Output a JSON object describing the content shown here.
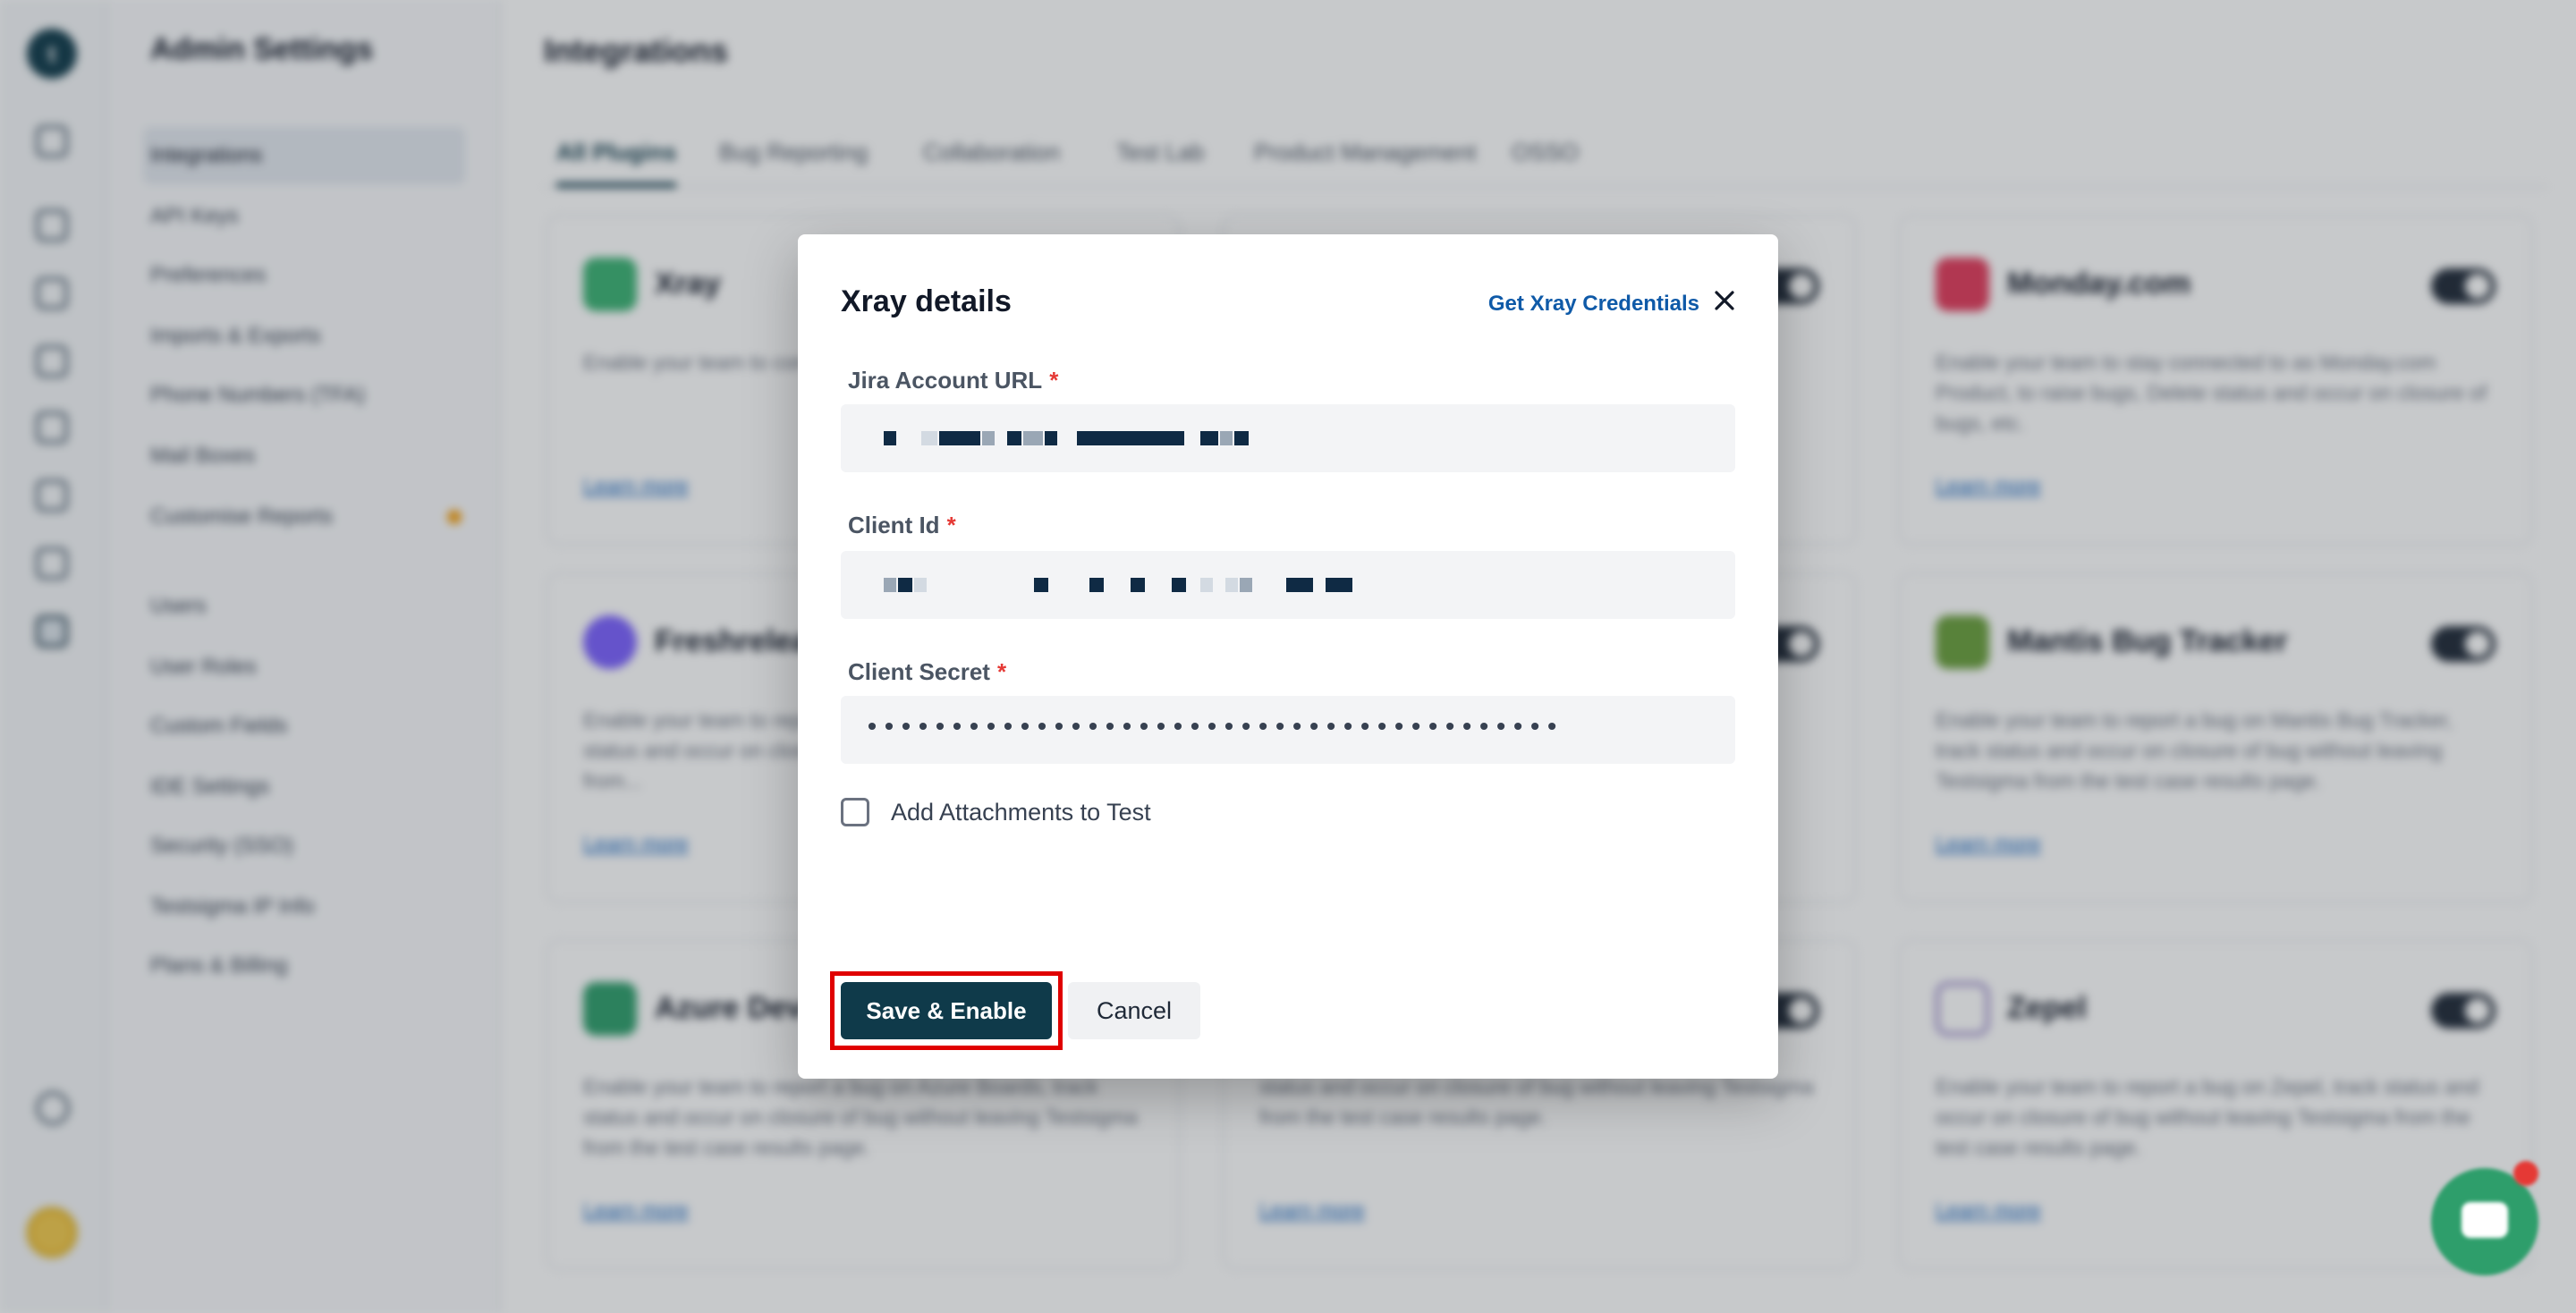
{
  "rail": {
    "logo_letter": "t"
  },
  "sidebar": {
    "title": "Admin Settings",
    "items": [
      {
        "label": "Integrations"
      },
      {
        "label": "API Keys"
      },
      {
        "label": "Preferences"
      },
      {
        "label": "Imports & Exports"
      },
      {
        "label": "Phone Numbers (TFA)"
      },
      {
        "label": "Mail Boxes"
      },
      {
        "label": "Customise Reports"
      },
      {
        "label": "Users"
      },
      {
        "label": "User Roles"
      },
      {
        "label": "Custom Fields"
      },
      {
        "label": "IDE Settings"
      },
      {
        "label": "Security (SSO)"
      },
      {
        "label": "Testsigma IP Info"
      },
      {
        "label": "Plans & Billing"
      }
    ]
  },
  "main": {
    "title": "Integrations",
    "tabs": [
      {
        "label": "All Plugins"
      },
      {
        "label": "Bug Reporting"
      },
      {
        "label": "Collaboration"
      },
      {
        "label": "Test Lab"
      },
      {
        "label": "Product Management"
      },
      {
        "label": "OSSO"
      }
    ],
    "cards": [
      {
        "name": "Xray",
        "description": "Enable your team to connect to Xray and push Executions...",
        "link": "Learn more",
        "logo_color": "#3bb273"
      },
      {
        "name": "Monday.com",
        "description": "Enable your team to stay connected to as Monday.com Product, to raise bugs, Delete status and occur on closure of bugs, etc.",
        "link": "Learn more",
        "logo_color": "#e23b5b"
      },
      {
        "name": "Freshrelease",
        "description": "Enable your team to report a bug on Freshrelease, track status and occur on closure of bug without leaving Testsigma from...",
        "link": "Learn more",
        "logo_color": "#7b61ff"
      },
      {
        "name": "Mantis Bug Tracker",
        "description": "Enable your team to report a bug on Mantis Bug Tracker, track status and occur on closure of bug without leaving Testsigma from the test case results page.",
        "link": "Learn more",
        "logo_color": "#6a9f3c"
      },
      {
        "name": "Azure DevOps",
        "description": "Enable your team to report a bug on Azure Boards, track status and occur on closure of bug without leaving Testsigma from the test case results page.",
        "link": "Learn more",
        "logo_color": "#2e9e6b"
      },
      {
        "name": "",
        "description": "status and occur on closure of bug without leaving Testsigma from the test case results page.",
        "link": "Learn more",
        "logo_color": "#cccccc"
      },
      {
        "name": "Zepel",
        "description": "Enable your team to report a bug on Zepel, track status and occur on closure of bug without leaving Testsigma from the test case results page.",
        "link": "Learn more",
        "logo_color": "#8e7cc3"
      }
    ]
  },
  "modal": {
    "title": "Xray details",
    "credentials_link": "Get Xray Credentials",
    "fields": [
      {
        "label": "Jira Account URL",
        "required_mark": "*"
      },
      {
        "label": "Client Id",
        "required_mark": "*"
      },
      {
        "label": "Client Secret",
        "required_mark": "*",
        "masked_value": "••••••••••••••••••••••••••••••••••••••••••••••••••••••••••••••••"
      }
    ],
    "checkbox_label": "Add Attachments to Test",
    "save_label": "Save & Enable",
    "cancel_label": "Cancel"
  }
}
